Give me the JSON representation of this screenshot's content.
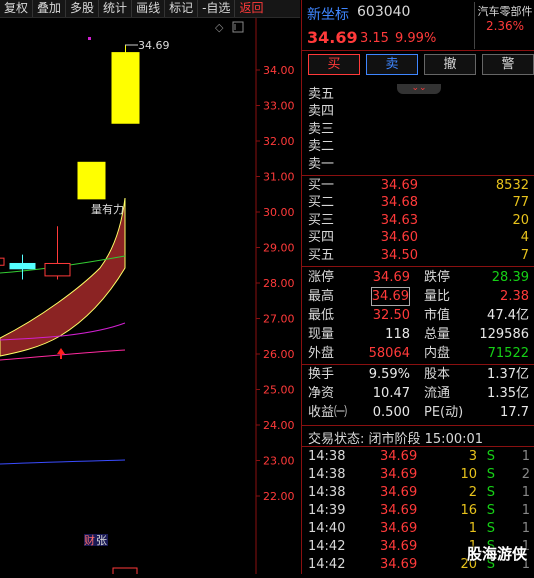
{
  "toolbar": {
    "items": [
      "复权",
      "叠加",
      "多股",
      "统计",
      "画线",
      "标记",
      "-自选"
    ],
    "back": "返回"
  },
  "chart": {
    "y_ticks": [
      "34.00",
      "33.00",
      "32.00",
      "31.00",
      "30.00",
      "29.00",
      "28.00",
      "27.00",
      "26.00",
      "25.00",
      "24.00",
      "23.00",
      "22.00"
    ],
    "high_label": "34.69",
    "annotation": "量有力",
    "finance_tag": "财",
    "finance_tag2": "张",
    "colors": {
      "bull_candle": "#ffff00",
      "cyan_candle": "#5ff",
      "band": "#a52a2a"
    }
  },
  "chart_data": {
    "type": "candlestick",
    "y_range": [
      21.5,
      35.0
    ],
    "y_ticks": [
      34,
      33,
      32,
      31,
      30,
      29,
      28,
      27,
      26,
      25,
      24,
      23,
      22
    ],
    "candles": [
      {
        "open": 28.7,
        "close": 28.5,
        "high": 29.3,
        "low": 28.1,
        "color": "red-hollow"
      },
      {
        "open": 28.55,
        "close": 28.4,
        "high": 28.8,
        "low": 28.1,
        "color": "cyan"
      },
      {
        "open": 28.2,
        "close": 28.55,
        "high": 29.6,
        "low": 28.1,
        "color": "red-hollow"
      },
      {
        "open": 30.37,
        "close": 31.4,
        "high": 31.4,
        "low": 30.37,
        "color": "yellow"
      },
      {
        "open": 32.5,
        "close": 34.49,
        "high": 34.69,
        "low": 32.5,
        "color": "yellow"
      }
    ],
    "high_marker": 34.69
  },
  "quote": {
    "name": "新坐标",
    "code": "603040",
    "price": "34.69",
    "change": "3.15",
    "pct": "9.99%",
    "sector_name": "汽车零部件",
    "sector_pct": "2.36%"
  },
  "buttons": {
    "buy": "买",
    "sell": "卖",
    "cancel": "撤",
    "alert": "警"
  },
  "asks": [
    {
      "label": "卖五",
      "price": "",
      "vol": ""
    },
    {
      "label": "卖四",
      "price": "",
      "vol": ""
    },
    {
      "label": "卖三",
      "price": "",
      "vol": ""
    },
    {
      "label": "卖二",
      "price": "",
      "vol": ""
    },
    {
      "label": "卖一",
      "price": "",
      "vol": ""
    }
  ],
  "bids": [
    {
      "label": "买一",
      "price": "34.69",
      "vol": "8532"
    },
    {
      "label": "买二",
      "price": "34.68",
      "vol": "77"
    },
    {
      "label": "买三",
      "price": "34.63",
      "vol": "20"
    },
    {
      "label": "买四",
      "price": "34.60",
      "vol": "4"
    },
    {
      "label": "买五",
      "price": "34.50",
      "vol": "7"
    }
  ],
  "stats": [
    {
      "l1": "涨停",
      "v1": "34.69",
      "c1": "red",
      "l2": "跌停",
      "v2": "28.39",
      "c2": "green"
    },
    {
      "l1": "最高",
      "v1": "34.69",
      "c1": "red boxed",
      "l2": "量比",
      "v2": "2.38",
      "c2": "red"
    },
    {
      "l1": "最低",
      "v1": "32.50",
      "c1": "red",
      "l2": "市值",
      "v2": "47.4亿",
      "c2": "white"
    },
    {
      "l1": "现量",
      "v1": "118",
      "c1": "white",
      "l2": "总量",
      "v2": "129586",
      "c2": "white"
    },
    {
      "l1": "外盘",
      "v1": "58064",
      "c1": "red",
      "l2": "内盘",
      "v2": "71522",
      "c2": "green"
    },
    {
      "l1": "换手",
      "v1": "9.59%",
      "c1": "white",
      "l2": "股本",
      "v2": "1.37亿",
      "c2": "white"
    },
    {
      "l1": "净资",
      "v1": "10.47",
      "c1": "white",
      "l2": "流通",
      "v2": "1.35亿",
      "c2": "white"
    },
    {
      "l1": "收益㈠",
      "v1": "0.500",
      "c1": "white",
      "l2": "PE(动)",
      "v2": "17.7",
      "c2": "white"
    }
  ],
  "ts_status": "交易状态: 闭市阶段 15:00:01",
  "ticks": [
    {
      "t": "14:38",
      "p": "34.69",
      "v": "3",
      "bs": "S",
      "n": "1"
    },
    {
      "t": "14:38",
      "p": "34.69",
      "v": "10",
      "bs": "S",
      "n": "2"
    },
    {
      "t": "14:38",
      "p": "34.69",
      "v": "2",
      "bs": "S",
      "n": "1"
    },
    {
      "t": "14:39",
      "p": "34.69",
      "v": "16",
      "bs": "S",
      "n": "1"
    },
    {
      "t": "14:40",
      "p": "34.69",
      "v": "1",
      "bs": "S",
      "n": "1"
    },
    {
      "t": "14:42",
      "p": "34.69",
      "v": "1",
      "bs": "S",
      "n": "1"
    },
    {
      "t": "14:42",
      "p": "34.69",
      "v": "20",
      "bs": "S",
      "n": "1"
    }
  ],
  "watermark": "股海游侠"
}
